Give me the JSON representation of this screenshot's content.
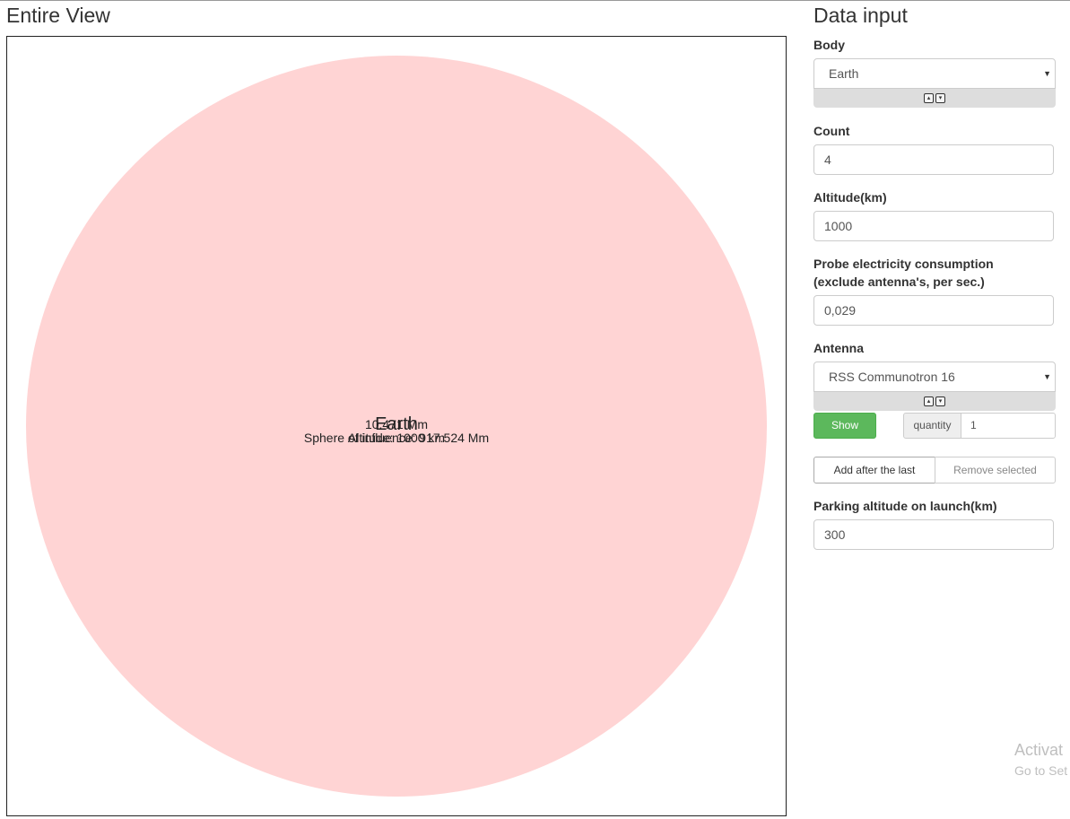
{
  "entire_view": {
    "title": "Entire View",
    "body_name": "Earth",
    "labels": {
      "radius": "10.471 Mm",
      "sphere_of_influence": "Sphere of influence: 917.524 Mm",
      "altitude": "Altitude: 1000 km"
    },
    "body_color": "#ffd4d4"
  },
  "data_input": {
    "title": "Data input",
    "body": {
      "label": "Body",
      "selected": "Earth"
    },
    "count": {
      "label": "Count",
      "value": "4"
    },
    "altitude": {
      "label": "Altitude(km)",
      "value": "1000"
    },
    "probe_consumption": {
      "label_line1": "Probe electricity consumption",
      "label_line2": "(exclude antenna's, per sec.)",
      "value": "0,029"
    },
    "antenna": {
      "label": "Antenna",
      "selected": "RSS Communotron 16",
      "show_label": "Show",
      "quantity_label": "quantity",
      "quantity_value": "1"
    },
    "add_after_last_label": "Add after the last",
    "remove_selected_label": "Remove selected",
    "parking_altitude": {
      "label": "Parking altitude on launch(km)",
      "value": "300"
    }
  },
  "os_watermark": {
    "line1": "Activat",
    "line2": "Go to Set"
  },
  "colors": {
    "show_button": "#5cb85c",
    "expander_bar": "#dddddd"
  }
}
